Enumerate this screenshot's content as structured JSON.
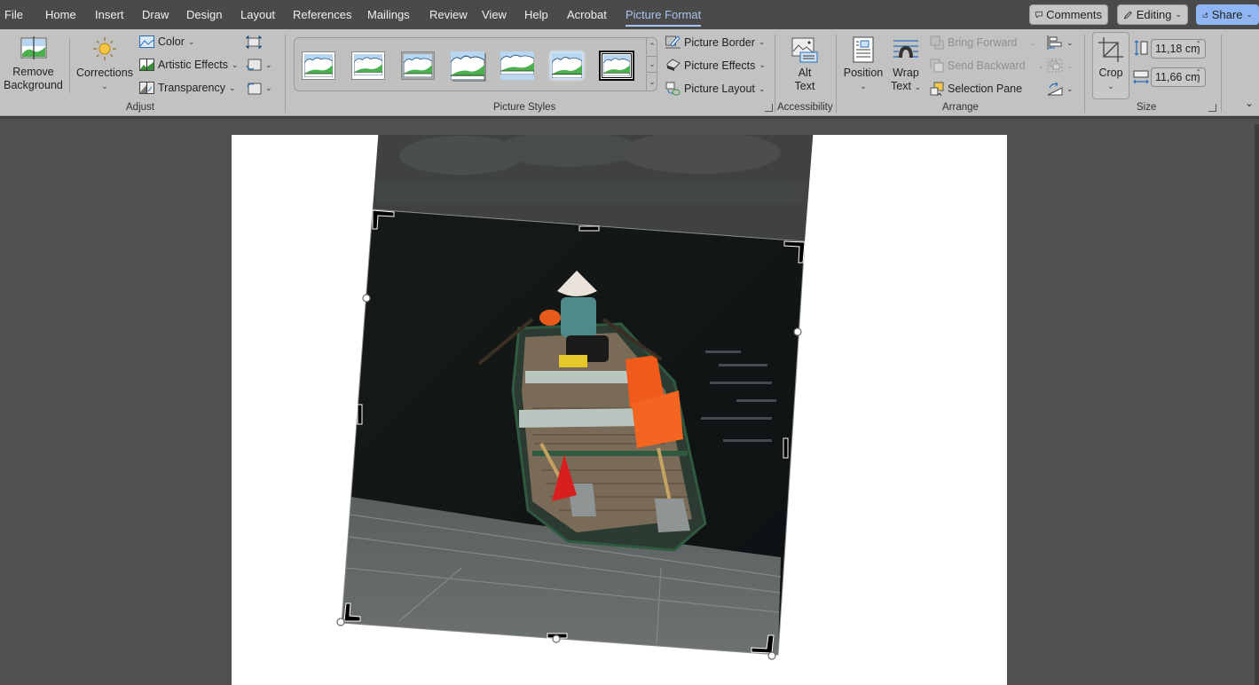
{
  "menubar": {
    "tabs": [
      {
        "label": "File"
      },
      {
        "label": "Home"
      },
      {
        "label": "Insert"
      },
      {
        "label": "Draw"
      },
      {
        "label": "Design"
      },
      {
        "label": "Layout"
      },
      {
        "label": "References"
      },
      {
        "label": "Mailings"
      },
      {
        "label": "Review"
      },
      {
        "label": "View"
      },
      {
        "label": "Help"
      },
      {
        "label": "Acrobat"
      },
      {
        "label": "Picture Format",
        "active": true
      }
    ],
    "comments_label": "Comments",
    "editing_label": "Editing",
    "share_label": "Share"
  },
  "ribbon": {
    "adjust": {
      "group_label": "Adjust",
      "remove_background": {
        "line1": "Remove",
        "line2": "Background"
      },
      "corrections_label": "Corrections",
      "color_label": "Color",
      "artistic_effects_label": "Artistic Effects",
      "transparency_label": "Transparency",
      "small_icons": [
        "compress-pictures-icon",
        "change-picture-icon",
        "reset-picture-icon"
      ]
    },
    "picture_styles": {
      "group_label": "Picture Styles",
      "styles_count": 7,
      "selected_style_index": 6,
      "picture_border_label": "Picture Border",
      "picture_effects_label": "Picture Effects",
      "picture_layout_label": "Picture Layout"
    },
    "accessibility": {
      "group_label": "Accessibility",
      "alt_text": {
        "line1": "Alt",
        "line2": "Text"
      }
    },
    "arrange": {
      "group_label": "Arrange",
      "position_label": "Position",
      "wrap_text": {
        "line1": "Wrap",
        "line2": "Text"
      },
      "bring_forward_label": "Bring Forward",
      "send_backward_label": "Send Backward",
      "selection_pane_label": "Selection Pane",
      "bring_forward_enabled": false,
      "send_backward_enabled": false
    },
    "size": {
      "group_label": "Size",
      "crop_label": "Crop",
      "height_value": "11,18 cm",
      "width_value": "11,66 cm"
    }
  },
  "document": {
    "image_description": "Rotated photo of a wooden rowboat with orange life jackets and a person in a conical hat, moored at stone steps on dark water; crop mode active with cropped-away area shown dimmed above",
    "mode": "crop"
  },
  "colors": {
    "active_tab": "#a9c3ef",
    "share_button": "#8fb6f2",
    "ribbon_bg": "#c2c2c2",
    "titlebar_bg": "#4a4a4a",
    "canvas_bg": "#505050"
  }
}
